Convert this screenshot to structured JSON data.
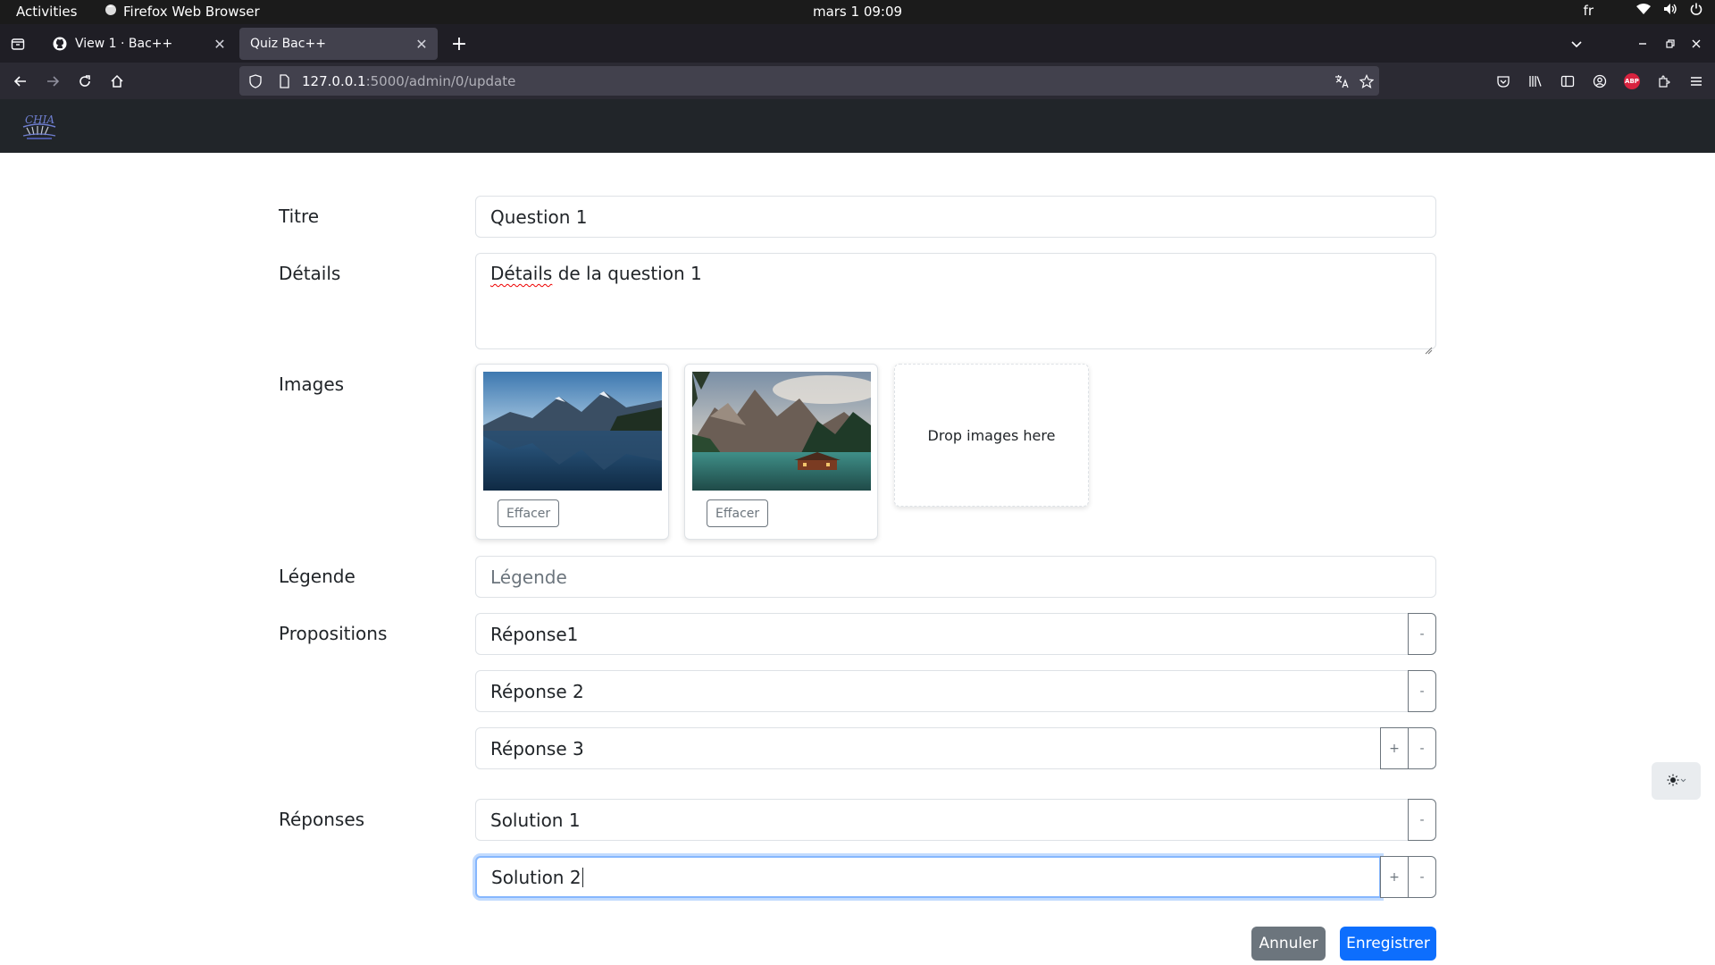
{
  "system": {
    "activities": "Activities",
    "app_name": "Firefox Web Browser",
    "clock": "mars 1  09:09",
    "language": "fr"
  },
  "browser": {
    "tabs": [
      {
        "title": "View 1 · Bac++",
        "icon": "github-icon",
        "active": false
      },
      {
        "title": "Quiz Bac++",
        "icon": "",
        "active": true
      }
    ],
    "url": {
      "host": "127.0.0.1",
      "path": ":5000/admin/0/update"
    }
  },
  "app": {
    "logo_alt": "CHIA"
  },
  "form": {
    "titre": {
      "label": "Titre",
      "value": "Question 1"
    },
    "details": {
      "label": "Détails",
      "value_word1": "Détails",
      "value_rest": " de la question 1"
    },
    "images": {
      "label": "Images",
      "items": [
        {
          "delete_label": "Effacer",
          "description": "mountain lake reflection"
        },
        {
          "delete_label": "Effacer",
          "description": "mountain lake with cabin"
        }
      ],
      "drop_label": "Drop images here"
    },
    "legende": {
      "label": "Légende",
      "placeholder": "Légende"
    },
    "propositions": {
      "label": "Propositions",
      "items": [
        "Réponse1",
        "Réponse 2",
        "Réponse 3"
      ],
      "add": "+",
      "remove": "-"
    },
    "reponses": {
      "label": "Réponses",
      "items": [
        "Solution 1",
        "Solution 2"
      ],
      "add": "+",
      "remove": "-"
    },
    "buttons": {
      "cancel": "Annuler",
      "save": "Enregistrer"
    }
  },
  "colors": {
    "primary": "#0d6efd",
    "secondary": "#6c757d",
    "header_bg": "#212529"
  }
}
